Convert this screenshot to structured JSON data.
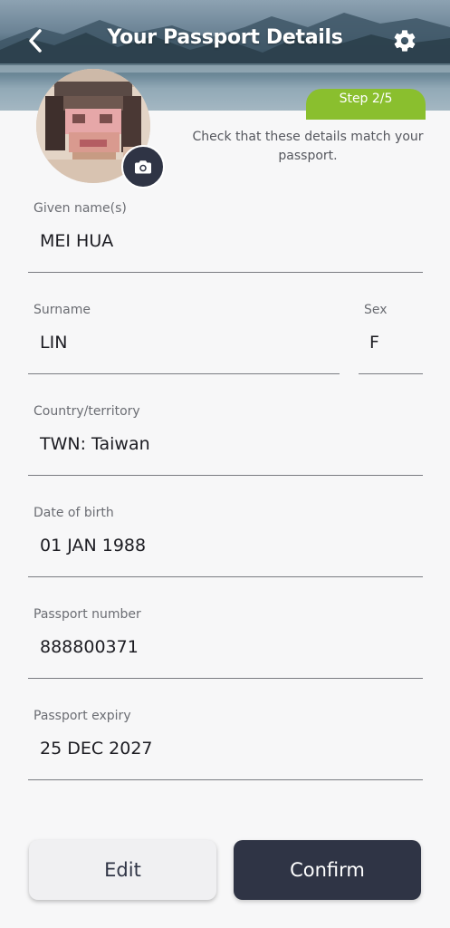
{
  "header": {
    "title": "Your Passport Details",
    "back_icon": "chevron-left-icon",
    "settings_icon": "gear-icon",
    "step": "Step 2/5",
    "step_color": "#8abf2e"
  },
  "photo": {
    "camera_icon": "camera-icon"
  },
  "instruction": "Check that these details match your passport.",
  "fields": {
    "given_name": {
      "label": "Given name(s)",
      "value": "MEI HUA"
    },
    "surname": {
      "label": "Surname",
      "value": "LIN"
    },
    "sex": {
      "label": "Sex",
      "value": "F"
    },
    "country": {
      "label": "Country/territory",
      "value": "TWN: Taiwan"
    },
    "dob": {
      "label": "Date of birth",
      "value": "01 JAN 1988"
    },
    "passport_number": {
      "label": "Passport number",
      "value": "888800371"
    },
    "passport_expiry": {
      "label": "Passport expiry",
      "value": "25 DEC 2027"
    }
  },
  "buttons": {
    "edit": "Edit",
    "confirm": "Confirm"
  },
  "colors": {
    "primary_dark": "#2f3445",
    "accent_green": "#8abf2e"
  }
}
